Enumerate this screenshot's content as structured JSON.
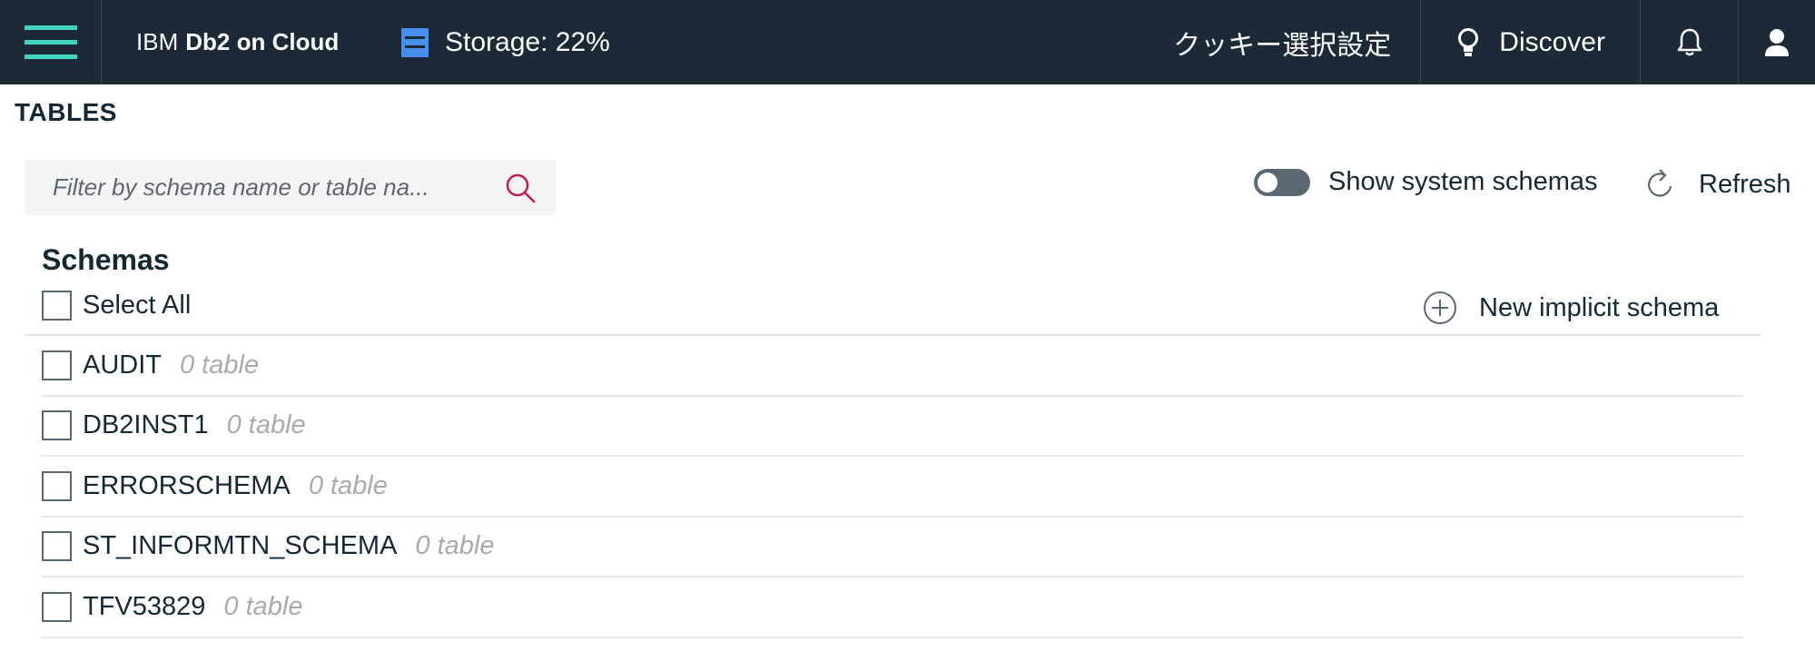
{
  "header": {
    "brand_ibm": "IBM",
    "brand_product": "Db2 on Cloud",
    "storage_text": "Storage: 22%",
    "cookie_label": "クッキー選択設定",
    "discover_label": "Discover",
    "colors": {
      "bar_bg": "#1c2a38",
      "accent_teal": "#41d6c3",
      "storage_blue": "#4a8ef0"
    }
  },
  "page": {
    "title": "TABLES"
  },
  "search": {
    "placeholder": "Filter by schema name or table na...",
    "value": ""
  },
  "toolbar": {
    "toggle_label": "Show system schemas",
    "toggle_on": false,
    "refresh_label": "Refresh"
  },
  "schemas": {
    "heading": "Schemas",
    "select_all_label": "Select All",
    "new_schema_label": "New implicit schema",
    "items": [
      {
        "name": "AUDIT",
        "count": "0 table"
      },
      {
        "name": "DB2INST1",
        "count": "0 table"
      },
      {
        "name": "ERRORSCHEMA",
        "count": "0 table"
      },
      {
        "name": "ST_INFORMTN_SCHEMA",
        "count": "0 table"
      },
      {
        "name": "TFV53829",
        "count": "0 table"
      }
    ]
  }
}
